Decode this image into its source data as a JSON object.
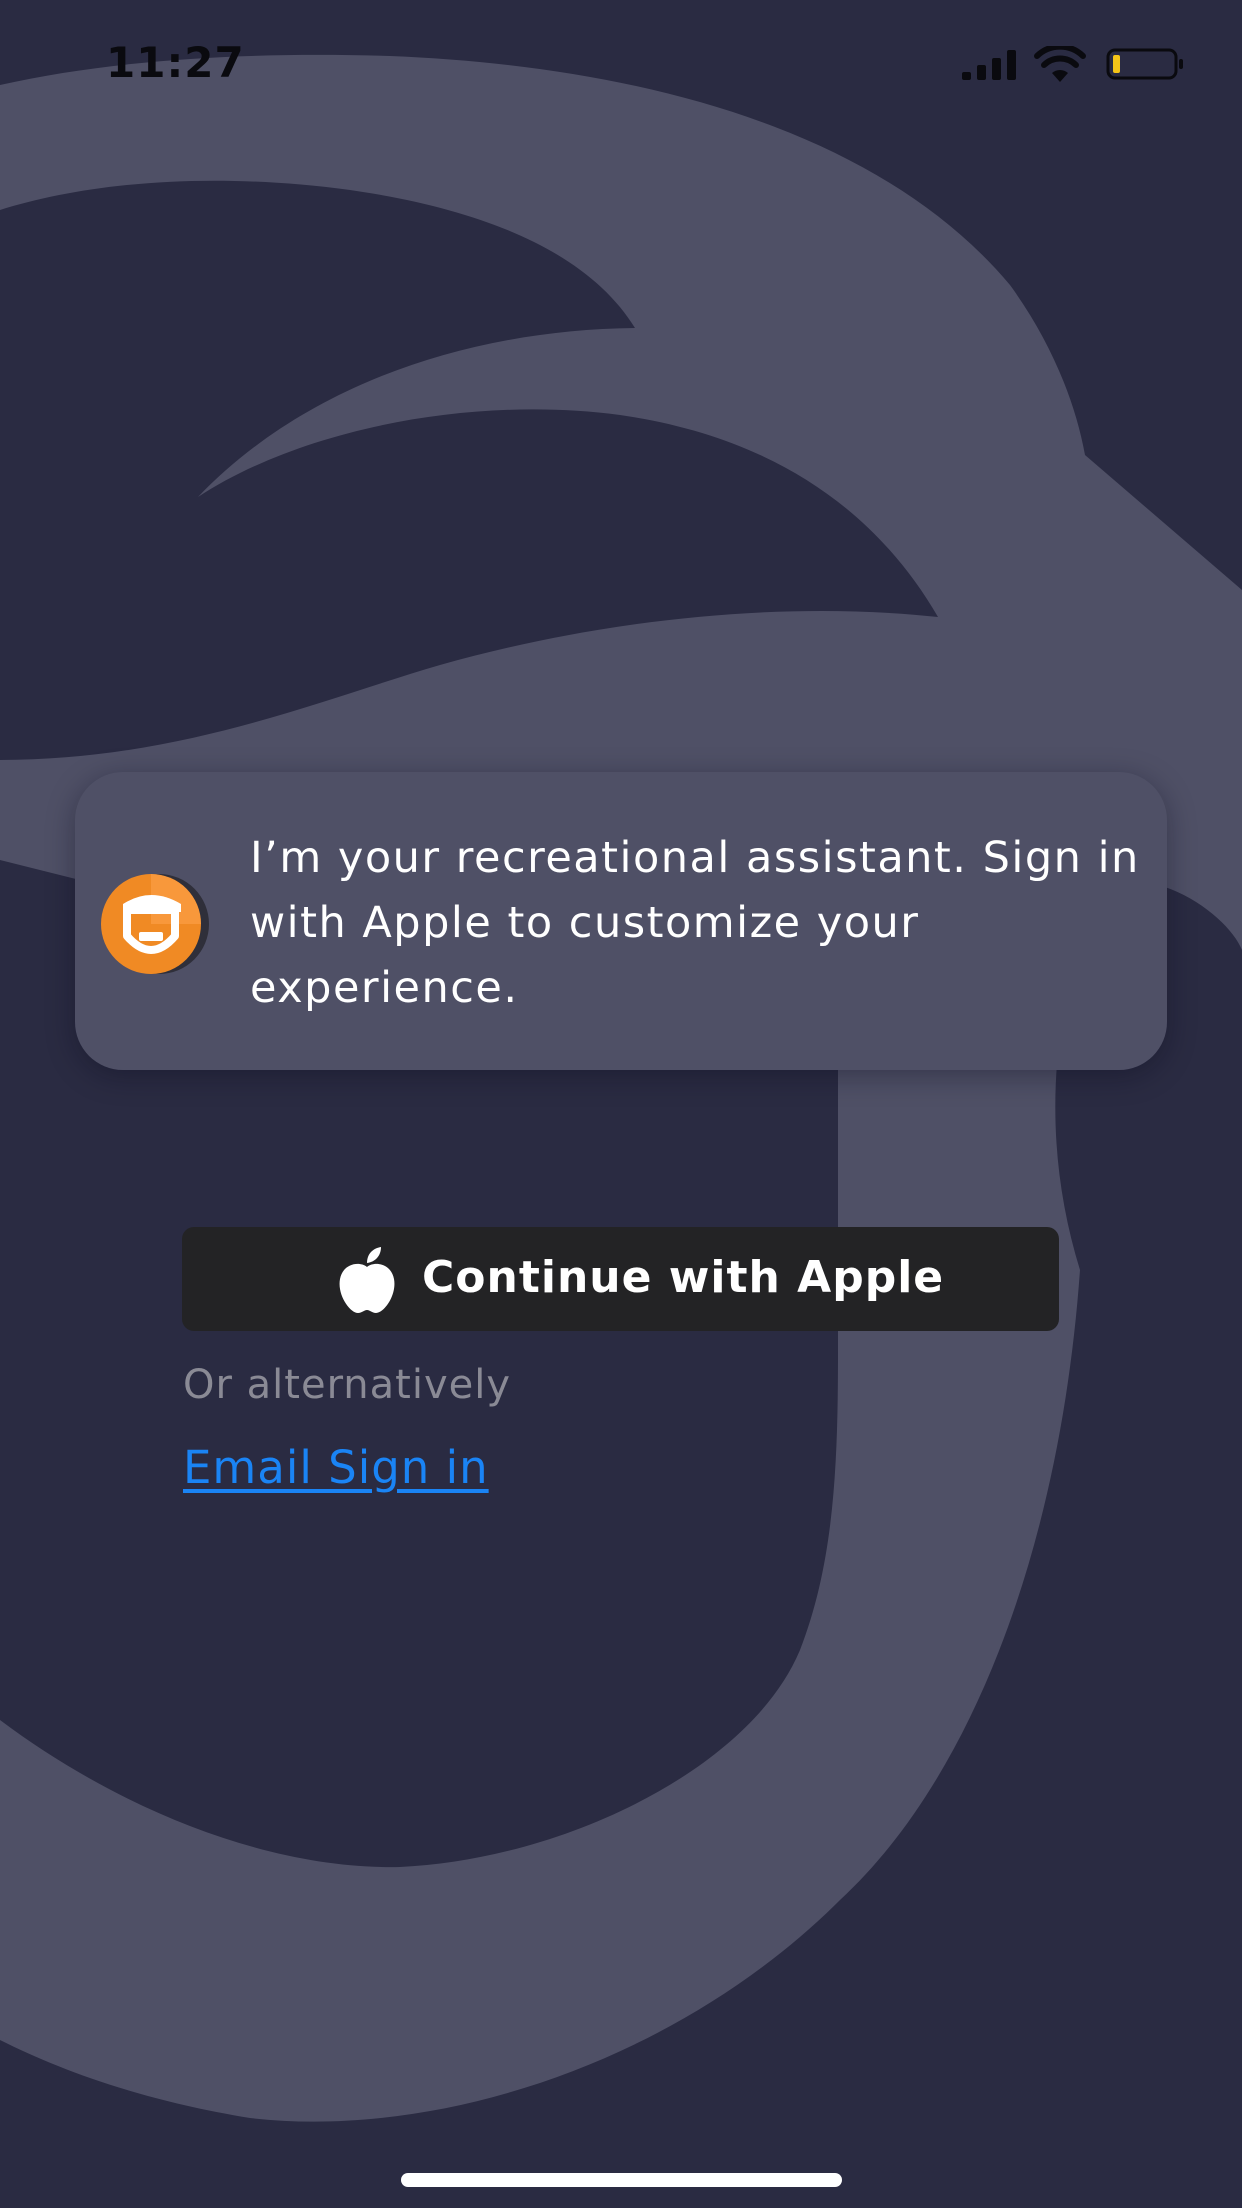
{
  "status_bar": {
    "time": "11:27",
    "icons": [
      "cellular-signal-icon",
      "wifi-icon",
      "battery-low-icon"
    ]
  },
  "assistant": {
    "avatar_icon": "assistant-mascot-icon",
    "message": "I’m your recreational assistant. Sign in with Apple to customize your experience."
  },
  "auth": {
    "apple_button_label": "Continue with Apple",
    "apple_icon": "apple-logo-icon",
    "alternative_text": "Or alternatively",
    "email_link_label": "Email Sign in"
  },
  "colors": {
    "background": "#2a2b42",
    "background_art": "#4f5066",
    "card": "#4f5066",
    "apple_button": "#232325",
    "link": "#1a84f5",
    "muted_text": "#8a8a95",
    "battery_level": "#f5c518",
    "avatar_orange": "#f08a24"
  }
}
